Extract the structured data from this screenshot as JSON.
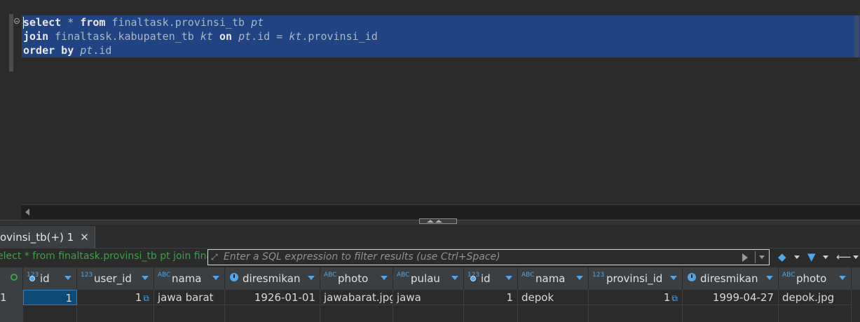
{
  "editor": {
    "lines": [
      {
        "kw1": "select",
        "rest1": " * ",
        "kw2": "from",
        "rest2": " finaltask.provinsi_tb ",
        "alias": "pt"
      },
      {
        "kw1": "join",
        "rest1": " finaltask.kabupaten_tb ",
        "alias1": "kt",
        "kw2": " on ",
        "a1": "pt",
        "r1": ".id = ",
        "a2": "kt",
        "r2": ".provinsi_id"
      },
      {
        "kw1": "order by",
        "rest1": " ",
        "alias": "pt",
        "rest2": ".id"
      }
    ]
  },
  "results": {
    "tab_label": "ovinsi_tb(+) 1",
    "query_preview": "elect * from finaltask.provinsi_tb pt join finalt",
    "filter_placeholder": "Enter a SQL expression to filter results (use Ctrl+Space)",
    "columns": [
      {
        "type": "123",
        "label": "id",
        "icon": "key-icon"
      },
      {
        "type": "123",
        "label": "user_id"
      },
      {
        "type": "ABC",
        "label": "nama"
      },
      {
        "type": "",
        "label": "diresmikan",
        "icon": "clock-icon"
      },
      {
        "type": "ABC",
        "label": "photo"
      },
      {
        "type": "ABC",
        "label": "pulau"
      },
      {
        "type": "123",
        "label": "id",
        "icon": "key-icon"
      },
      {
        "type": "ABC",
        "label": "nama"
      },
      {
        "type": "123",
        "label": "provinsi_id"
      },
      {
        "type": "",
        "label": "diresmikan",
        "icon": "clock-icon"
      },
      {
        "type": "ABC",
        "label": "photo"
      }
    ],
    "row": {
      "row_number": "1",
      "cells": [
        "1",
        "1",
        "jawa barat",
        "1926-01-01",
        "jawabarat.jpg",
        "jawa",
        "1",
        "depok",
        "1",
        "1999-04-27",
        "depok.jpg"
      ]
    }
  },
  "colors": {
    "accent": "#4ea6ea",
    "selection": "#214283",
    "query_green": "#39a247"
  }
}
